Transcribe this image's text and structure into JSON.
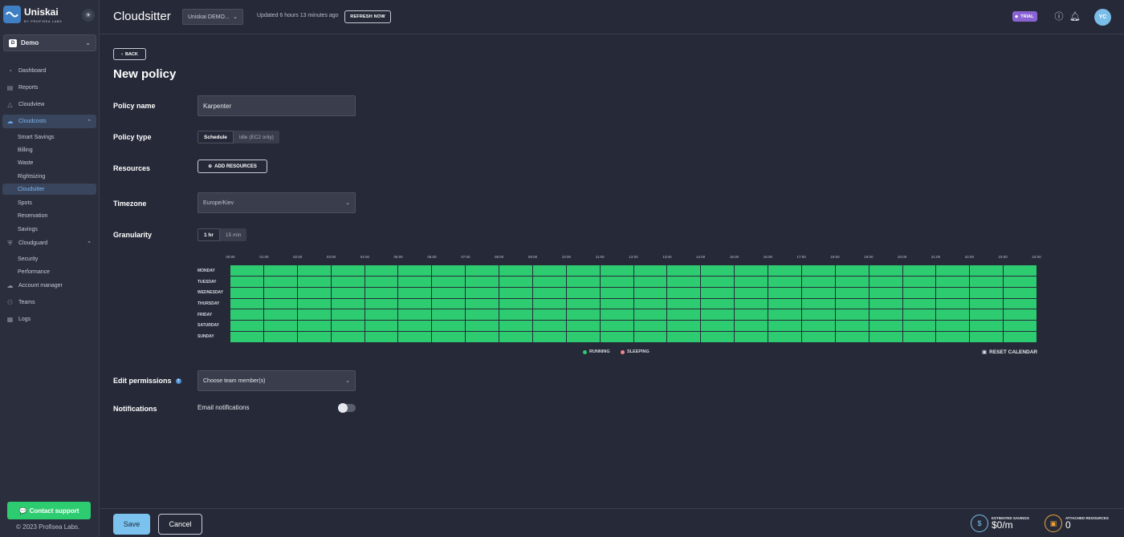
{
  "brand": {
    "name": "Uniskai",
    "sub": "BY PROFISEA LABS"
  },
  "sidebar": {
    "org": {
      "badge": "D",
      "name": "Demo"
    },
    "nav": [
      {
        "label": "Dashboard",
        "icon": "dashboard-icon"
      },
      {
        "label": "Reports",
        "icon": "reports-icon"
      },
      {
        "label": "Cloudview",
        "icon": "cloudview-icon"
      },
      {
        "label": "Cloudcosts",
        "icon": "cloudcosts-icon"
      },
      {
        "label": "Cloudguard",
        "icon": "shield-icon"
      },
      {
        "label": "Account manager",
        "icon": "cloud-icon"
      },
      {
        "label": "Teams",
        "icon": "teams-icon"
      },
      {
        "label": "Logs",
        "icon": "logs-icon"
      }
    ],
    "cloudcosts_sub": [
      "Smart Savings",
      "Billing",
      "Waste",
      "Rightsizing",
      "Cloudsitter",
      "Spots",
      "Reservation",
      "Savings"
    ],
    "cloudguard_sub": [
      "Security",
      "Performance"
    ],
    "support_label": "Contact support",
    "copyright": "© 2023 Profisea Labs."
  },
  "header": {
    "title": "Cloudsitter",
    "account": "Uniskai DEMO...",
    "updated": "Updated 6 hours 13 minutes ago",
    "refresh_label": "REFRESH NOW",
    "trial_label": "TRIAL",
    "avatar": "YC"
  },
  "form": {
    "back_label": "BACK",
    "heading": "New policy",
    "policy_name_label": "Policy name",
    "policy_name_value": "Karpenter",
    "policy_type_label": "Policy type",
    "policy_types": [
      "Schedule",
      "Idle (EC2 only)"
    ],
    "resources_label": "Resources",
    "add_resources_label": "ADD RESOURCES",
    "timezone_label": "Timezone",
    "timezone_value": "Europe/Kiev",
    "granularity_label": "Granularity",
    "granularity_options": [
      "1 hr",
      "15 min"
    ],
    "hours": [
      "00:00",
      "01:00",
      "02:00",
      "03:00",
      "04:00",
      "05:00",
      "06:00",
      "07:00",
      "08:00",
      "09:00",
      "10:00",
      "11:00",
      "12:00",
      "13:00",
      "14:00",
      "15:00",
      "16:00",
      "17:00",
      "18:00",
      "19:00",
      "20:00",
      "21:00",
      "22:00",
      "23:00",
      "24:00"
    ],
    "days": [
      "MONDAY",
      "TUESDAY",
      "WEDNESDAY",
      "THURSDAY",
      "FRIDAY",
      "SATURDAY",
      "SUNDAY"
    ],
    "legend_running": "RUNNING",
    "legend_sleeping": "SLEEPING",
    "reset_label": "RESET CALENDAR",
    "permissions_label": "Edit permissions",
    "permissions_placeholder": "Choose team member(s)",
    "notifications_label": "Notifications",
    "email_label": "Email notifications",
    "email_enabled": false
  },
  "footer": {
    "save_label": "Save",
    "cancel_label": "Cancel",
    "savings_label": "ESTIMATED SAVINGS",
    "savings_value": "$0/m",
    "attached_label": "ATTACHED RESOURCES",
    "attached_value": "0"
  },
  "colors": {
    "running": "#2ecc71",
    "sleeping": "#f08a8a",
    "accent": "#7bc3ee",
    "trial": "#8a63d2"
  }
}
